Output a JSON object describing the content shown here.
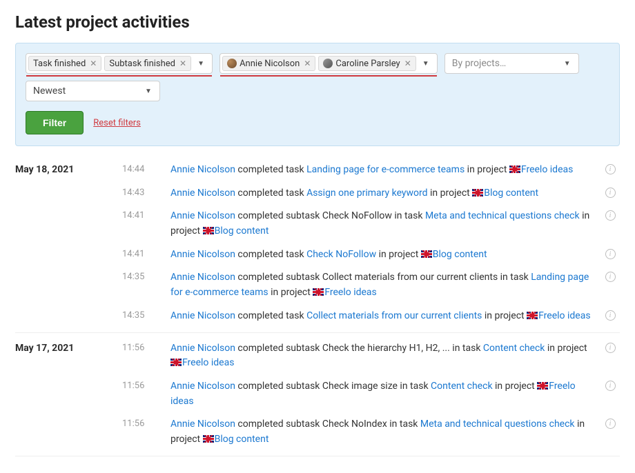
{
  "page_title": "Latest project activities",
  "filters": {
    "type_chips": [
      "Task finished",
      "Subtask finished"
    ],
    "user_chips": [
      "Annie Nicolson",
      "Caroline Parsley"
    ],
    "project_placeholder": "By projects…",
    "sort_value": "Newest",
    "filter_button": "Filter",
    "reset_link": "Reset filters"
  },
  "days": [
    {
      "date": "May 18, 2021",
      "rows": [
        {
          "time": "14:44",
          "segments": [
            {
              "t": "user",
              "v": "Annie Nicolson"
            },
            {
              "t": "text",
              "v": " completed task "
            },
            {
              "t": "link",
              "v": "Landing page for e-commerce teams"
            },
            {
              "t": "text",
              "v": " in project "
            },
            {
              "t": "flag"
            },
            {
              "t": "link",
              "v": "Freelo ideas"
            }
          ]
        },
        {
          "time": "14:43",
          "segments": [
            {
              "t": "user",
              "v": "Annie Nicolson"
            },
            {
              "t": "text",
              "v": " completed task "
            },
            {
              "t": "link",
              "v": "Assign one primary keyword"
            },
            {
              "t": "text",
              "v": " in project "
            },
            {
              "t": "flag"
            },
            {
              "t": "link",
              "v": "Blog content"
            }
          ]
        },
        {
          "time": "14:41",
          "segments": [
            {
              "t": "user",
              "v": "Annie Nicolson"
            },
            {
              "t": "text",
              "v": " completed subtask Check NoFollow in task "
            },
            {
              "t": "link",
              "v": "Meta and technical questions check"
            },
            {
              "t": "text",
              "v": " in project "
            },
            {
              "t": "flag"
            },
            {
              "t": "link",
              "v": "Blog content"
            }
          ]
        },
        {
          "time": "14:41",
          "segments": [
            {
              "t": "user",
              "v": "Annie Nicolson"
            },
            {
              "t": "text",
              "v": " completed task "
            },
            {
              "t": "link",
              "v": "Check NoFollow"
            },
            {
              "t": "text",
              "v": " in project "
            },
            {
              "t": "flag"
            },
            {
              "t": "link",
              "v": "Blog content"
            }
          ]
        },
        {
          "time": "14:35",
          "segments": [
            {
              "t": "user",
              "v": "Annie Nicolson"
            },
            {
              "t": "text",
              "v": " completed subtask Collect materials from our current clients in task "
            },
            {
              "t": "link",
              "v": "Landing page for e-commerce teams"
            },
            {
              "t": "text",
              "v": " in project "
            },
            {
              "t": "flag"
            },
            {
              "t": "link",
              "v": "Freelo ideas"
            }
          ]
        },
        {
          "time": "14:35",
          "segments": [
            {
              "t": "user",
              "v": "Annie Nicolson"
            },
            {
              "t": "text",
              "v": " completed task "
            },
            {
              "t": "link",
              "v": "Collect materials from our current clients"
            },
            {
              "t": "text",
              "v": " in project "
            },
            {
              "t": "flag"
            },
            {
              "t": "link",
              "v": "Freelo ideas"
            }
          ]
        }
      ]
    },
    {
      "date": "May 17, 2021",
      "rows": [
        {
          "time": "11:56",
          "segments": [
            {
              "t": "user",
              "v": "Annie Nicolson"
            },
            {
              "t": "text",
              "v": " completed subtask Check the hierarchy H1, H2, ... in task "
            },
            {
              "t": "link",
              "v": "Content check"
            },
            {
              "t": "text",
              "v": " in project "
            },
            {
              "t": "flag"
            },
            {
              "t": "link",
              "v": "Freelo ideas"
            }
          ]
        },
        {
          "time": "11:56",
          "segments": [
            {
              "t": "user",
              "v": "Annie Nicolson"
            },
            {
              "t": "text",
              "v": " completed subtask Check image size in task "
            },
            {
              "t": "link",
              "v": "Content check"
            },
            {
              "t": "text",
              "v": " in project "
            },
            {
              "t": "flag"
            },
            {
              "t": "link",
              "v": "Freelo ideas"
            }
          ]
        },
        {
          "time": "11:56",
          "segments": [
            {
              "t": "user",
              "v": "Annie Nicolson"
            },
            {
              "t": "text",
              "v": " completed subtask Check NoIndex in task "
            },
            {
              "t": "link",
              "v": "Meta and technical questions check"
            },
            {
              "t": "text",
              "v": " in project "
            },
            {
              "t": "flag"
            },
            {
              "t": "link",
              "v": "Blog content"
            }
          ]
        }
      ]
    }
  ]
}
